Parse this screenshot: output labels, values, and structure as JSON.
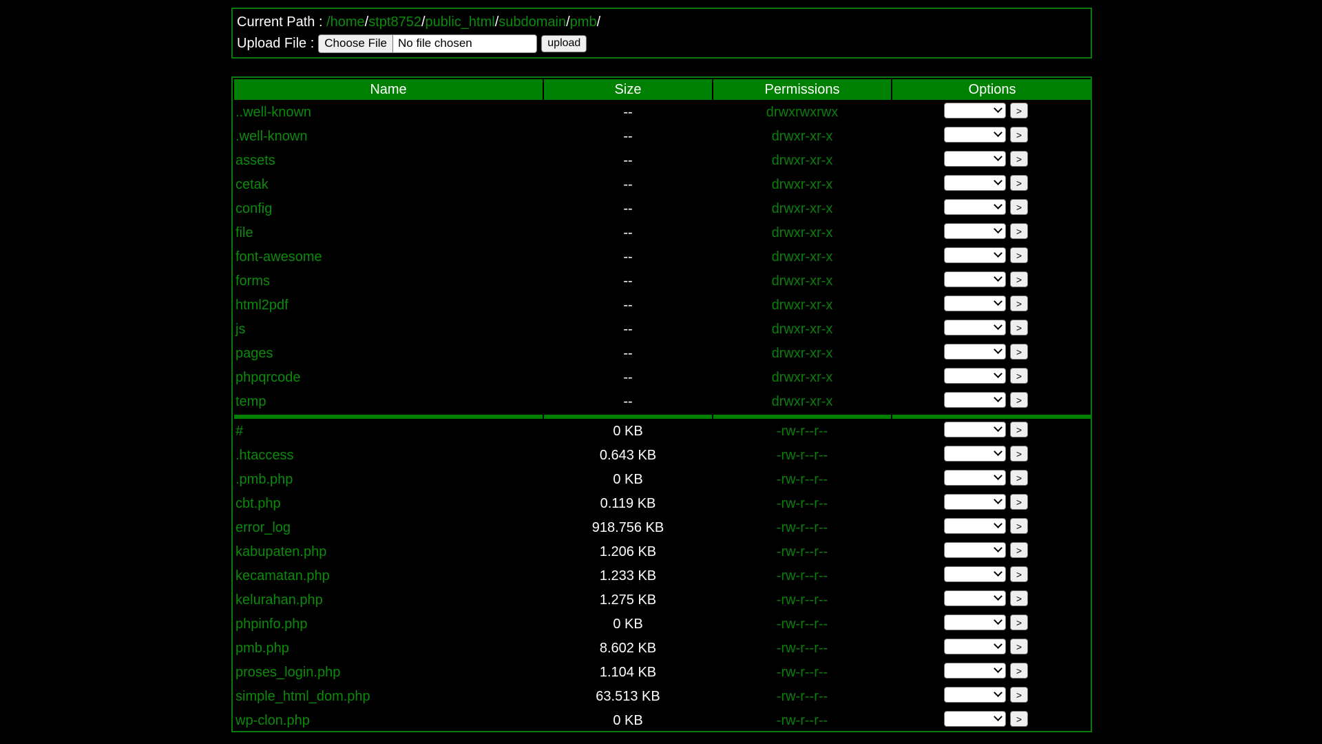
{
  "header": {
    "current_path_label": "Current Path :",
    "path_root_sep": "/",
    "path_segments": [
      "home",
      "stpt8752",
      "public_html",
      "subdomain",
      "pmb"
    ],
    "trailing_sep": "/",
    "upload_label": "Upload File :",
    "choose_file_label": "Choose File",
    "no_file_text": "No file chosen",
    "upload_button": "upload"
  },
  "table": {
    "columns": [
      "Name",
      "Size",
      "Permissions",
      "Options"
    ],
    "directories": [
      {
        "name": "..well-known",
        "size": "--",
        "perm": "drwxrwxrwx"
      },
      {
        "name": ".well-known",
        "size": "--",
        "perm": "drwxr-xr-x"
      },
      {
        "name": "assets",
        "size": "--",
        "perm": "drwxr-xr-x"
      },
      {
        "name": "cetak",
        "size": "--",
        "perm": "drwxr-xr-x"
      },
      {
        "name": "config",
        "size": "--",
        "perm": "drwxr-xr-x"
      },
      {
        "name": "file",
        "size": "--",
        "perm": "drwxr-xr-x"
      },
      {
        "name": "font-awesome",
        "size": "--",
        "perm": "drwxr-xr-x"
      },
      {
        "name": "forms",
        "size": "--",
        "perm": "drwxr-xr-x"
      },
      {
        "name": "html2pdf",
        "size": "--",
        "perm": "drwxr-xr-x"
      },
      {
        "name": "js",
        "size": "--",
        "perm": "drwxr-xr-x"
      },
      {
        "name": "pages",
        "size": "--",
        "perm": "drwxr-xr-x"
      },
      {
        "name": "phpqrcode",
        "size": "--",
        "perm": "drwxr-xr-x"
      },
      {
        "name": "temp",
        "size": "--",
        "perm": "drwxr-xr-x"
      }
    ],
    "files": [
      {
        "name": "#",
        "size": "0 KB",
        "perm": "-rw-r--r--"
      },
      {
        "name": ".htaccess",
        "size": "0.643 KB",
        "perm": "-rw-r--r--"
      },
      {
        "name": ".pmb.php",
        "size": "0 KB",
        "perm": "-rw-r--r--"
      },
      {
        "name": "cbt.php",
        "size": "0.119 KB",
        "perm": "-rw-r--r--"
      },
      {
        "name": "error_log",
        "size": "918.756 KB",
        "perm": "-rw-r--r--"
      },
      {
        "name": "kabupaten.php",
        "size": "1.206 KB",
        "perm": "-rw-r--r--"
      },
      {
        "name": "kecamatan.php",
        "size": "1.233 KB",
        "perm": "-rw-r--r--"
      },
      {
        "name": "kelurahan.php",
        "size": "1.275 KB",
        "perm": "-rw-r--r--"
      },
      {
        "name": "phpinfo.php",
        "size": "0 KB",
        "perm": "-rw-r--r--"
      },
      {
        "name": "pmb.php",
        "size": "8.602 KB",
        "perm": "-rw-r--r--"
      },
      {
        "name": "proses_login.php",
        "size": "1.104 KB",
        "perm": "-rw-r--r--"
      },
      {
        "name": "simple_html_dom.php",
        "size": "63.513 KB",
        "perm": "-rw-r--r--"
      },
      {
        "name": "wp-clon.php",
        "size": "0 KB",
        "perm": "-rw-r--r--"
      }
    ],
    "go_button": ">"
  },
  "colors": {
    "background": "#000000",
    "accent_green": "#008000",
    "link_green": "#0c8a0c"
  }
}
